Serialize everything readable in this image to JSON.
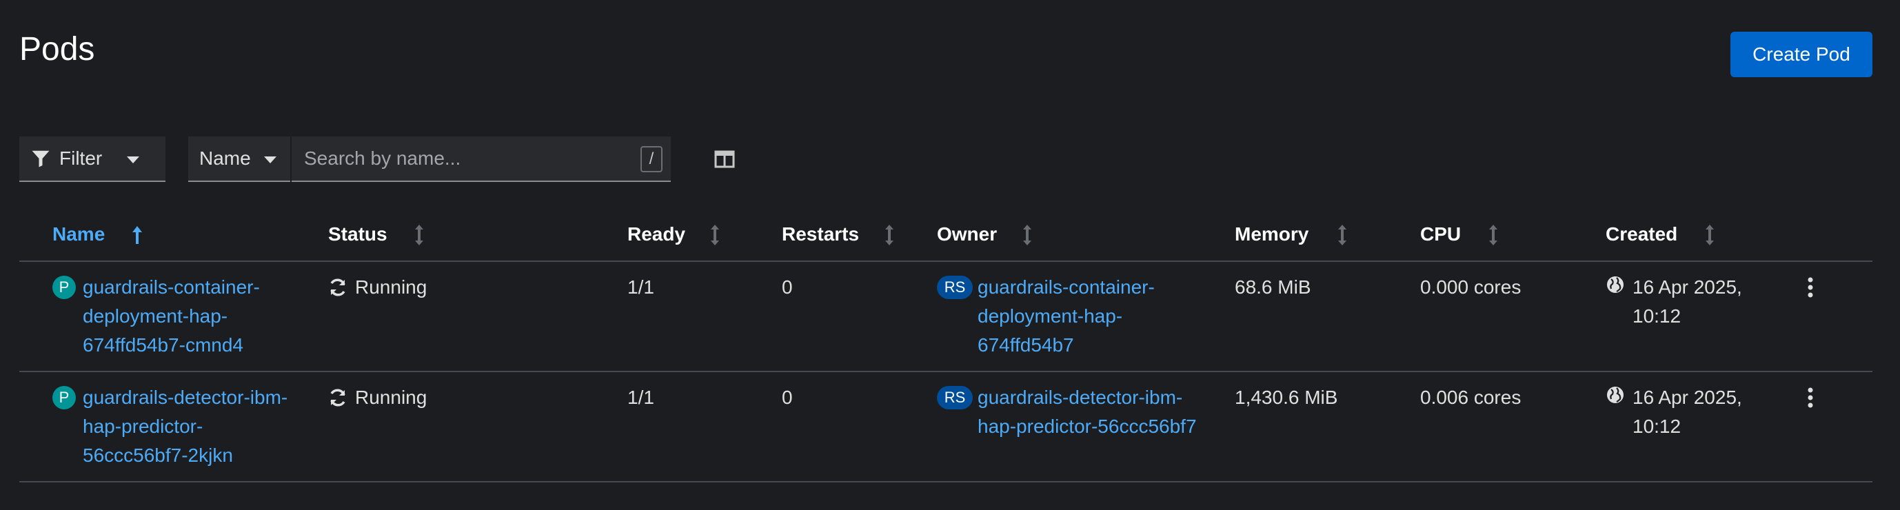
{
  "page": {
    "title": "Pods",
    "create_label": "Create Pod"
  },
  "toolbar": {
    "filter_label": "Filter",
    "attribute_label": "Name",
    "search_placeholder": "Search by name...",
    "search_shortcut": "/"
  },
  "table": {
    "columns": [
      "Name",
      "Status",
      "Ready",
      "Restarts",
      "Owner",
      "Memory",
      "CPU",
      "Created"
    ],
    "rows": [
      {
        "name_badge": "P",
        "name_lines": [
          "guardrails-container-",
          "deployment-hap-",
          "674ffd54b7-cmnd4"
        ],
        "status": "Running",
        "ready": "1/1",
        "restarts": "0",
        "owner_badge": "RS",
        "owner_lines": [
          "guardrails-container-",
          "deployment-hap-",
          "674ffd54b7"
        ],
        "memory": "68.6 MiB",
        "cpu": "0.000 cores",
        "created_lines": [
          "16 Apr 2025,",
          "10:12"
        ]
      },
      {
        "name_badge": "P",
        "name_lines": [
          "guardrails-detector-ibm-",
          "hap-predictor-",
          "56ccc56bf7-2kjkn"
        ],
        "status": "Running",
        "ready": "1/1",
        "restarts": "0",
        "owner_badge": "RS",
        "owner_lines": [
          "guardrails-detector-ibm-",
          "hap-predictor-56ccc56bf7"
        ],
        "memory": "1,430.6 MiB",
        "cpu": "0.006 cores",
        "created_lines": [
          "16 Apr 2025,",
          "10:12"
        ]
      }
    ]
  },
  "colors": {
    "accent": "#0066cc",
    "link": "#4dabf7",
    "pod_badge": "#009596",
    "rs_badge": "#004d99",
    "background": "#1b1d21"
  }
}
